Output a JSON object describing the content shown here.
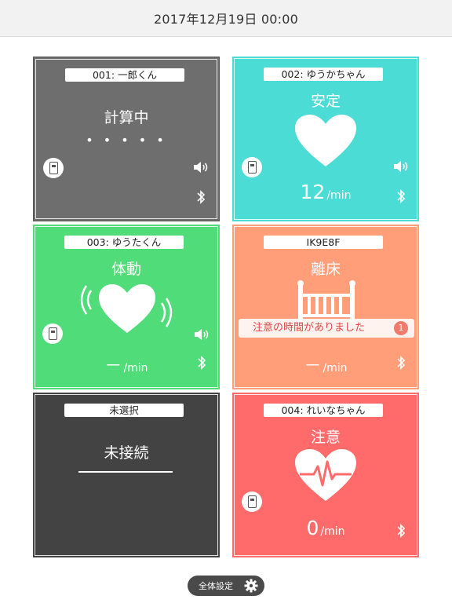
{
  "header": {
    "datetime": "2017年12月19日 00:00"
  },
  "cards": [
    {
      "name": "001: 一郎くん",
      "status": "計算中",
      "dots": "• • • • •",
      "color": "#6e6e6e"
    },
    {
      "name": "002: ゆうかちゃん",
      "status": "安定",
      "rate": "12",
      "unit": "/min",
      "color": "#4cdcd6"
    },
    {
      "name": "003: ゆうたくん",
      "status": "体動",
      "rate": "－",
      "unit": "/min",
      "color": "#4fdc79"
    },
    {
      "name": "IK9E8F",
      "status": "離床",
      "rate": "－",
      "unit": "/min",
      "color": "#ff9e79",
      "alert": {
        "text": "注意の時間がありました",
        "count": "1"
      }
    },
    {
      "name": "未選択",
      "status": "未接続",
      "color": "#434343"
    },
    {
      "name": "004: れいなちゃん",
      "status": "注意",
      "rate": "0",
      "unit": "/min",
      "color": "#ff6b6b"
    }
  ],
  "footer": {
    "settings_label": "全体設定"
  }
}
